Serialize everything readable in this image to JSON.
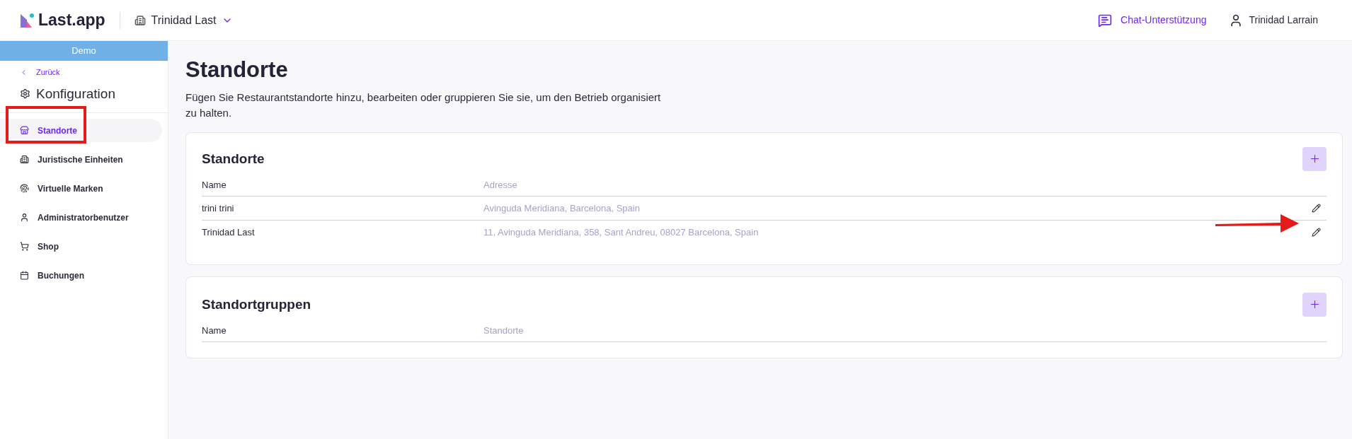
{
  "header": {
    "logo": "Last.app",
    "location": "Trinidad Last",
    "support": "Chat-Unterstützung",
    "user": "Trinidad Larrain"
  },
  "sidebar": {
    "banner": "Demo",
    "back": "Zurück",
    "title": "Konfiguration",
    "items": [
      {
        "label": "Standorte",
        "selected": true
      },
      {
        "label": "Juristische Einheiten",
        "selected": false
      },
      {
        "label": "Virtuelle Marken",
        "selected": false
      },
      {
        "label": "Administratorbenutzer",
        "selected": false
      },
      {
        "label": "Shop",
        "selected": false
      },
      {
        "label": "Buchungen",
        "selected": false
      }
    ]
  },
  "page": {
    "title": "Standorte",
    "description": "Fügen Sie Restaurantstandorte hinzu, bearbeiten oder gruppieren Sie sie, um den Betrieb organisiert zu halten."
  },
  "cards": [
    {
      "title": "Standorte",
      "columns": [
        "Name",
        "Adresse"
      ],
      "rows": [
        {
          "cells": [
            "trini trini",
            "Avinguda Meridiana, Barcelona, Spain"
          ]
        },
        {
          "cells": [
            "Trinidad Last",
            "11, Avinguda Meridiana, 358, Sant Andreu, 08027 Barcelona, Spain"
          ]
        }
      ]
    },
    {
      "title": "Standortgruppen",
      "columns": [
        "Name",
        "Standorte"
      ]
    }
  ]
}
